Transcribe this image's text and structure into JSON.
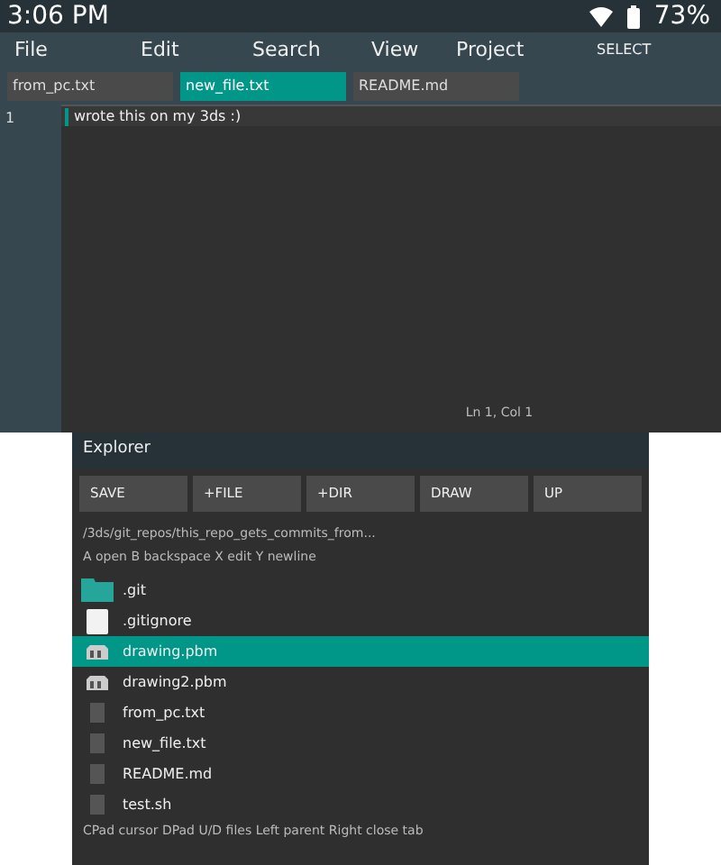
{
  "status_bar": {
    "time": "3:06 PM",
    "battery": "73%"
  },
  "menu": [
    {
      "label": "File"
    },
    {
      "label": "Edit"
    },
    {
      "label": "Search"
    },
    {
      "label": "View"
    },
    {
      "label": "Project"
    },
    {
      "label": "SELECT"
    }
  ],
  "tabs": [
    {
      "label": "from_pc.txt",
      "selected": false
    },
    {
      "label": "new_file.txt",
      "selected": true
    },
    {
      "label": "README.md",
      "selected": false
    }
  ],
  "editor": {
    "lines": [
      {
        "number": "1",
        "text": "wrote this on my 3ds :)"
      }
    ],
    "position": "Ln 1, Col 1"
  },
  "explorer": {
    "title": "Explorer",
    "buttons": [
      "SAVE",
      "+FILE",
      "+DIR",
      "DRAW",
      "UP"
    ],
    "path": "/3ds/git_repos/this_repo_gets_commits_from...",
    "hint": "A open  B backspace  X edit  Y newline",
    "files": [
      {
        "name": ".git",
        "kind": "folder",
        "selected": false
      },
      {
        "name": ".gitignore",
        "kind": "file",
        "selected": false
      },
      {
        "name": "drawing.pbm",
        "kind": "image",
        "selected": true
      },
      {
        "name": "drawing2.pbm",
        "kind": "image",
        "selected": false
      },
      {
        "name": "from_pc.txt",
        "kind": "text",
        "selected": false
      },
      {
        "name": "new_file.txt",
        "kind": "text",
        "selected": false
      },
      {
        "name": "README.md",
        "kind": "text",
        "selected": false
      },
      {
        "name": "test.sh",
        "kind": "text",
        "selected": false
      }
    ],
    "help": "CPad cursor  DPad U/D files  Left parent  Right close tab"
  }
}
